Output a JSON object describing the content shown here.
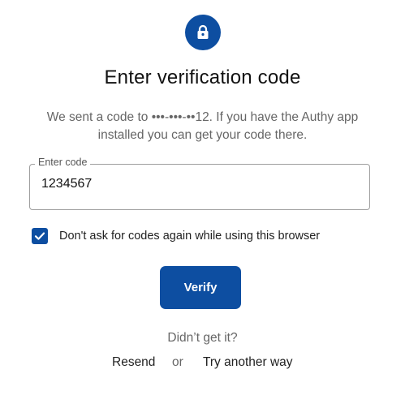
{
  "header": {
    "icon": "lock-icon",
    "title": "Enter verification code",
    "subtitle_line1": "We sent a code to •••-•••-••12. If you have the Authy app",
    "subtitle_line2": "installed you can get your code there."
  },
  "code_field": {
    "label": "Enter code",
    "value": "1234567"
  },
  "remember": {
    "checked": true,
    "label": "Don't ask for codes again while using this browser"
  },
  "actions": {
    "verify_label": "Verify",
    "didnt_get": "Didn’t get it?",
    "resend_label": "Resend",
    "or_text": "or",
    "try_another_label": "Try another way"
  },
  "colors": {
    "accent": "#0d4ea1",
    "muted_text": "#666666",
    "border": "#9e9e9e"
  }
}
